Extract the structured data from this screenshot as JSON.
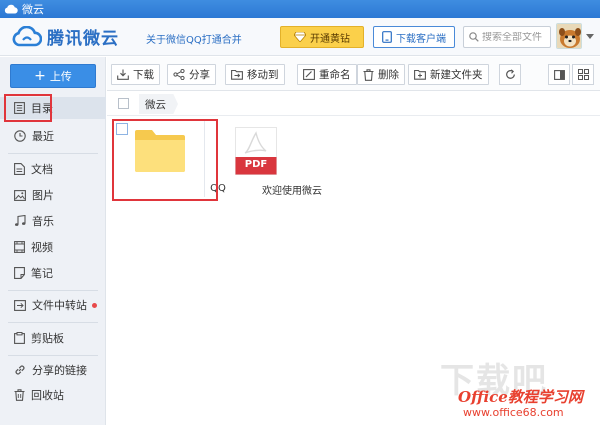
{
  "window": {
    "title": "微云"
  },
  "header": {
    "logo_text": "腾讯微云",
    "slogan": "关于微信QQ打通合并",
    "vip_label": "开通黄钻",
    "download_label": "下载客户端",
    "search_placeholder": "搜索全部文件"
  },
  "sidebar": {
    "upload_label": "上传",
    "items": [
      {
        "label": "目录",
        "icon": "list-icon"
      },
      {
        "label": "最近",
        "icon": "clock-icon"
      },
      {
        "label": "文档",
        "icon": "document-icon"
      },
      {
        "label": "图片",
        "icon": "image-icon"
      },
      {
        "label": "音乐",
        "icon": "music-icon"
      },
      {
        "label": "视频",
        "icon": "video-icon"
      },
      {
        "label": "笔记",
        "icon": "note-icon"
      },
      {
        "label": "文件中转站",
        "icon": "transfer-icon"
      },
      {
        "label": "剪贴板",
        "icon": "clipboard-icon"
      },
      {
        "label": "分享的链接",
        "icon": "link-icon"
      },
      {
        "label": "回收站",
        "icon": "trash-icon"
      }
    ]
  },
  "toolbar": {
    "download": "下载",
    "share": "分享",
    "move": "移动到",
    "rename": "重命名",
    "delete": "删除",
    "new_folder": "新建文件夹"
  },
  "breadcrumb": {
    "current": "微云"
  },
  "files": [
    {
      "name": "QQ",
      "type": "folder"
    },
    {
      "name": "欢迎使用微云",
      "type": "pdf",
      "badge": "PDF"
    }
  ],
  "watermark": {
    "big": "下载吧",
    "office": "Office教程学习网",
    "url": "www.office68.com"
  },
  "colors": {
    "accent": "#3a8ee6",
    "vip": "#fbd04a",
    "highlight": "#e0353b",
    "pdf": "#d9363e"
  }
}
